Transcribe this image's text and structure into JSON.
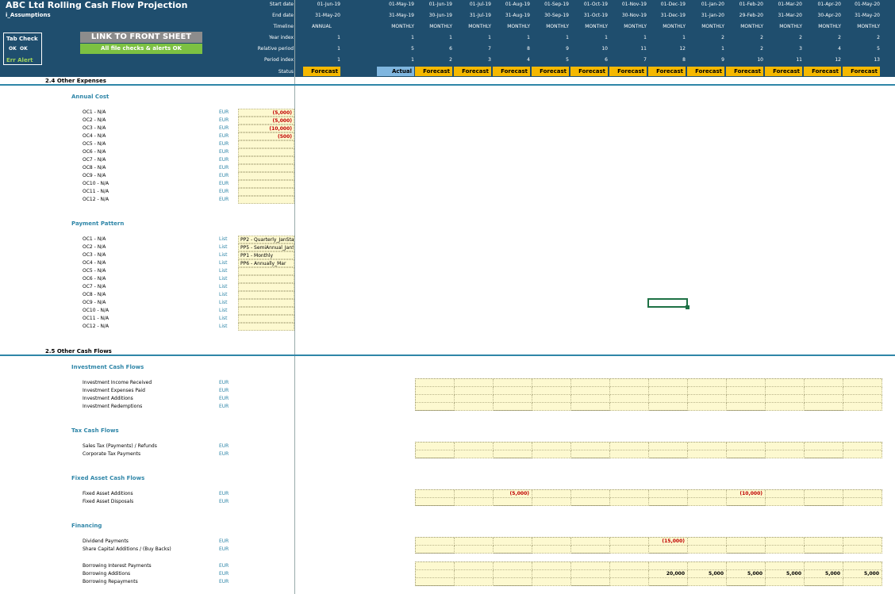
{
  "app": {
    "title": "ABC Ltd Rolling Cash Flow Projection",
    "sheet_name": "i_Assumptions"
  },
  "tab_check": {
    "heading": "Tab Check",
    "ok1": "OK",
    "ok2": "OK",
    "err_alert": "Err Alert"
  },
  "link_button": "LINK TO FRONT SHEET",
  "checks_status": "All file checks & alerts OK",
  "header": {
    "row_labels": [
      "Start date",
      "End date",
      "Timeline",
      "Year index",
      "Relative period",
      "Period index",
      "Status"
    ],
    "annual": {
      "start": "01-Jun-19",
      "end": "31-May-20",
      "timeline": "ANNUAL",
      "year": "1",
      "relative": "1",
      "period": "1",
      "status": "Forecast"
    },
    "columns": [
      {
        "start": "01-May-19",
        "end": "31-May-19",
        "timeline": "MONTHLY",
        "year": "1",
        "relative": "5",
        "period": "1",
        "status": "Actual"
      },
      {
        "start": "01-Jun-19",
        "end": "30-Jun-19",
        "timeline": "MONTHLY",
        "year": "1",
        "relative": "6",
        "period": "2",
        "status": "Forecast"
      },
      {
        "start": "01-Jul-19",
        "end": "31-Jul-19",
        "timeline": "MONTHLY",
        "year": "1",
        "relative": "7",
        "period": "3",
        "status": "Forecast"
      },
      {
        "start": "01-Aug-19",
        "end": "31-Aug-19",
        "timeline": "MONTHLY",
        "year": "1",
        "relative": "8",
        "period": "4",
        "status": "Forecast"
      },
      {
        "start": "01-Sep-19",
        "end": "30-Sep-19",
        "timeline": "MONTHLY",
        "year": "1",
        "relative": "9",
        "period": "5",
        "status": "Forecast"
      },
      {
        "start": "01-Oct-19",
        "end": "31-Oct-19",
        "timeline": "MONTHLY",
        "year": "1",
        "relative": "10",
        "period": "6",
        "status": "Forecast"
      },
      {
        "start": "01-Nov-19",
        "end": "30-Nov-19",
        "timeline": "MONTHLY",
        "year": "1",
        "relative": "11",
        "period": "7",
        "status": "Forecast"
      },
      {
        "start": "01-Dec-19",
        "end": "31-Dec-19",
        "timeline": "MONTHLY",
        "year": "1",
        "relative": "12",
        "period": "8",
        "status": "Forecast"
      },
      {
        "start": "01-Jan-20",
        "end": "31-Jan-20",
        "timeline": "MONTHLY",
        "year": "2",
        "relative": "1",
        "period": "9",
        "status": "Forecast"
      },
      {
        "start": "01-Feb-20",
        "end": "29-Feb-20",
        "timeline": "MONTHLY",
        "year": "2",
        "relative": "2",
        "period": "10",
        "status": "Forecast"
      },
      {
        "start": "01-Mar-20",
        "end": "31-Mar-20",
        "timeline": "MONTHLY",
        "year": "2",
        "relative": "3",
        "period": "11",
        "status": "Forecast"
      },
      {
        "start": "01-Apr-20",
        "end": "30-Apr-20",
        "timeline": "MONTHLY",
        "year": "2",
        "relative": "4",
        "period": "12",
        "status": "Forecast"
      },
      {
        "start": "01-May-20",
        "end": "31-May-20",
        "timeline": "MONTHLY",
        "year": "2",
        "relative": "5",
        "period": "13",
        "status": "Forecast"
      }
    ]
  },
  "section_other_expenses": {
    "title": "2.4  Other Expenses",
    "annual_cost": {
      "title": "Annual Cost",
      "rows": [
        {
          "label": "OC1 - N/A",
          "unit": "EUR",
          "value": "(5,000)"
        },
        {
          "label": "OC2 - N/A",
          "unit": "EUR",
          "value": "(5,000)"
        },
        {
          "label": "OC3 - N/A",
          "unit": "EUR",
          "value": "(10,000)"
        },
        {
          "label": "OC4 - N/A",
          "unit": "EUR",
          "value": "(500)"
        },
        {
          "label": "OC5 - N/A",
          "unit": "EUR",
          "value": ""
        },
        {
          "label": "OC6 - N/A",
          "unit": "EUR",
          "value": ""
        },
        {
          "label": "OC7 - N/A",
          "unit": "EUR",
          "value": ""
        },
        {
          "label": "OC8 - N/A",
          "unit": "EUR",
          "value": ""
        },
        {
          "label": "OC9 - N/A",
          "unit": "EUR",
          "value": ""
        },
        {
          "label": "OC10 - N/A",
          "unit": "EUR",
          "value": ""
        },
        {
          "label": "OC11 - N/A",
          "unit": "EUR",
          "value": ""
        },
        {
          "label": "OC12 - N/A",
          "unit": "EUR",
          "value": ""
        }
      ]
    },
    "payment_pattern": {
      "title": "Payment Pattern",
      "rows": [
        {
          "label": "OC1 - N/A",
          "unit": "List",
          "value": "PP2 - Quarterly_JanStart"
        },
        {
          "label": "OC2 - N/A",
          "unit": "List",
          "value": "PP5 - SemiAnnual_JanStart"
        },
        {
          "label": "OC3 - N/A",
          "unit": "List",
          "value": "PP1 - Monthly"
        },
        {
          "label": "OC4 - N/A",
          "unit": "List",
          "value": "PP6 - Annually_Mar"
        },
        {
          "label": "OC5 - N/A",
          "unit": "List",
          "value": ""
        },
        {
          "label": "OC6 - N/A",
          "unit": "List",
          "value": ""
        },
        {
          "label": "OC7 - N/A",
          "unit": "List",
          "value": ""
        },
        {
          "label": "OC8 - N/A",
          "unit": "List",
          "value": ""
        },
        {
          "label": "OC9 - N/A",
          "unit": "List",
          "value": ""
        },
        {
          "label": "OC10 - N/A",
          "unit": "List",
          "value": ""
        },
        {
          "label": "OC11 - N/A",
          "unit": "List",
          "value": ""
        },
        {
          "label": "OC12 - N/A",
          "unit": "List",
          "value": ""
        }
      ]
    }
  },
  "section_other_cash_flows": {
    "title": "2.5  Other Cash Flows",
    "groups": [
      {
        "title": "Investment Cash Flows",
        "rows": [
          {
            "label": "Investment Income Received",
            "unit": "EUR",
            "values": [
              "",
              "",
              "",
              "",
              "",
              "",
              "",
              "",
              "",
              "",
              "",
              ""
            ]
          },
          {
            "label": "Investment Expenses Paid",
            "unit": "EUR",
            "values": [
              "",
              "",
              "",
              "",
              "",
              "",
              "",
              "",
              "",
              "",
              "",
              ""
            ]
          },
          {
            "label": "Investment Additions",
            "unit": "EUR",
            "values": [
              "",
              "",
              "",
              "",
              "",
              "",
              "",
              "",
              "",
              "",
              "",
              ""
            ]
          },
          {
            "label": "Investment Redemptions",
            "unit": "EUR",
            "values": [
              "",
              "",
              "",
              "",
              "",
              "",
              "",
              "",
              "",
              "",
              "",
              ""
            ]
          }
        ]
      },
      {
        "title": "Tax Cash Flows",
        "rows": [
          {
            "label": "Sales Tax (Payments) / Refunds",
            "unit": "EUR",
            "values": [
              "",
              "",
              "",
              "",
              "",
              "",
              "",
              "",
              "",
              "",
              "",
              ""
            ]
          },
          {
            "label": "Corporate Tax Payments",
            "unit": "EUR",
            "values": [
              "",
              "",
              "",
              "",
              "",
              "",
              "",
              "",
              "",
              "",
              "",
              ""
            ]
          }
        ]
      },
      {
        "title": "Fixed Asset Cash Flows",
        "rows": [
          {
            "label": "Fixed Asset Additions",
            "unit": "EUR",
            "values": [
              "",
              "",
              "(5,000)",
              "",
              "",
              "",
              "",
              "",
              "(10,000)",
              "",
              "",
              ""
            ]
          },
          {
            "label": "Fixed Asset Disposals",
            "unit": "EUR",
            "values": [
              "",
              "",
              "",
              "",
              "",
              "",
              "",
              "",
              "",
              "",
              "",
              ""
            ]
          }
        ]
      },
      {
        "title": "Financing",
        "rows": [
          {
            "label": "Dividend Payments",
            "unit": "EUR",
            "values": [
              "",
              "",
              "",
              "",
              "",
              "",
              "(15,000)",
              "",
              "",
              "",
              "",
              ""
            ]
          },
          {
            "label": "Share Capital Additions / (Buy Backs)",
            "unit": "EUR",
            "values": [
              "",
              "",
              "",
              "",
              "",
              "",
              "",
              "",
              "",
              "",
              "",
              ""
            ]
          }
        ],
        "rows2": [
          {
            "label": "Borrowing Interest Payments",
            "unit": "EUR",
            "values": [
              "",
              "",
              "",
              "",
              "",
              "",
              "",
              "",
              "",
              "",
              "",
              ""
            ]
          },
          {
            "label": "Borrowing Additions",
            "unit": "EUR",
            "values": [
              "",
              "",
              "",
              "",
              "",
              "",
              "20,000",
              "5,000",
              "5,000",
              "5,000",
              "5,000",
              "5,000"
            ]
          },
          {
            "label": "Borrowing Repayments",
            "unit": "EUR",
            "values": [
              "",
              "",
              "",
              "",
              "",
              "",
              "",
              "",
              "",
              "",
              "",
              ""
            ]
          }
        ]
      }
    ]
  }
}
